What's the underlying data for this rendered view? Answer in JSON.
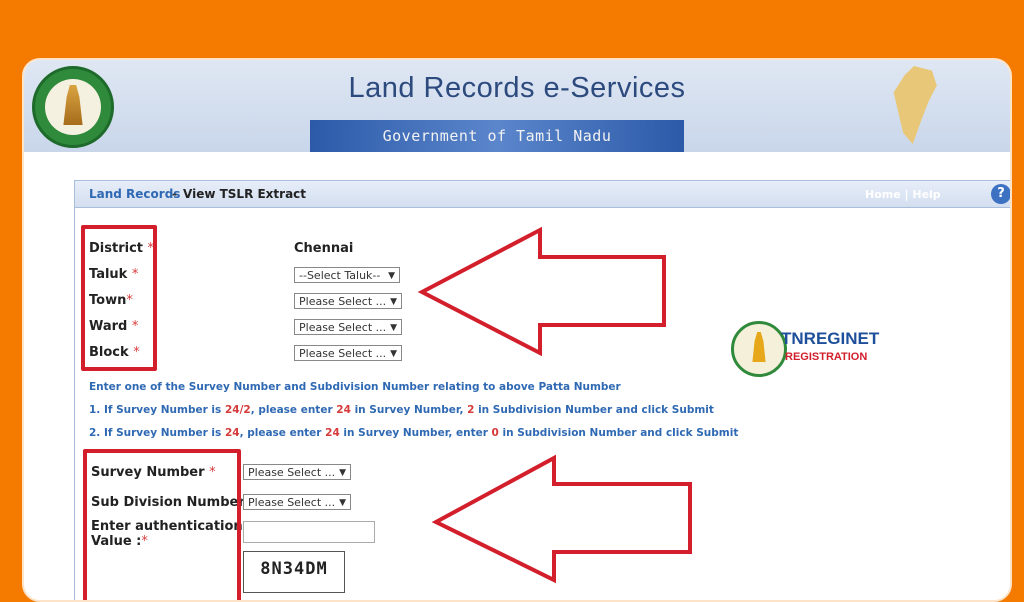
{
  "header": {
    "site_title": "Land Records e-Services",
    "gov_label": "Government of Tamil Nadu"
  },
  "panel": {
    "crumb_link": "Land Records",
    "crumb_separator": "-",
    "crumb_current": "View TSLR Extract",
    "head_links": "Home | Help",
    "help_symbol": "?"
  },
  "form": {
    "district_label": "District",
    "district_value": "Chennai",
    "taluk_label": "Taluk",
    "taluk_select": "--Select Taluk--",
    "town_label": "Town",
    "town_select": "Please Select ...",
    "ward_label": "Ward",
    "ward_select": "Please Select ...",
    "block_label": "Block",
    "block_select": "Please Select ...",
    "required_mark": "*",
    "survey_label": "Survey Number",
    "survey_select": "Please Select ...",
    "subdiv_label": "Sub Division Number",
    "subdiv_select": "Please Select ...",
    "auth_label_1": "Enter authentication",
    "auth_label_2": "Value :",
    "captcha_text": "8N34DM"
  },
  "instructions": {
    "line0": "Enter one of the Survey Number and Subdivision Number relating to above Patta Number",
    "line1": {
      "a": "1. If Survey Number is ",
      "b": "24/2",
      "c": ", please enter ",
      "d": "24",
      "e": " in Survey Number, ",
      "f": "2",
      "g": " in Subdivision Number and click Submit"
    },
    "line2": {
      "a": "2. If Survey Number is ",
      "b": "24",
      "c": ", please enter ",
      "d": "24",
      "e": " in Survey Number, enter ",
      "f": "0",
      "g": " in Subdivision Number and click Submit"
    }
  },
  "logo": {
    "name": "TNREGINET",
    "sub": "REGISTRATION"
  },
  "colors": {
    "outer_bg": "#f47a00",
    "highlight_red": "#d21f2b",
    "link_blue": "#2f69b3"
  }
}
